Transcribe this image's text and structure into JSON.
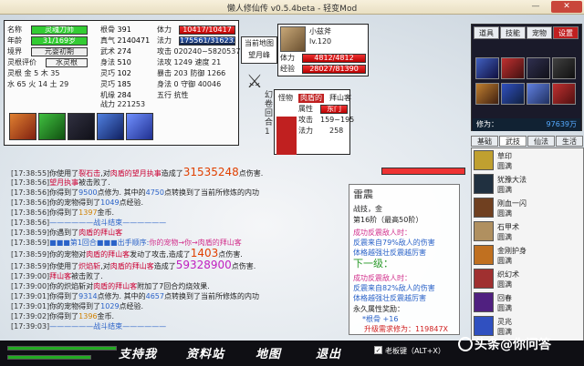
{
  "window": {
    "title": "懒人修仙传 v0.5.4beta - 轻变Mod",
    "minimize": "—",
    "close": "✕"
  },
  "player": {
    "name_label": "名称",
    "name": "灵魂刀师",
    "age_label": "年龄",
    "age": "31/169岁",
    "realm_label": "境界",
    "realm": "元婴初期",
    "root_label": "灵根评价",
    "root": "水灵根",
    "attr_label": "灵根",
    "attrs": "金 5 木 35",
    "attrs2": "水 65 火 14 土 29",
    "stats": [
      {
        "l": "根骨",
        "v": "391"
      },
      {
        "l": "真气",
        "v": "2140471"
      },
      {
        "l": "武术",
        "v": "274"
      },
      {
        "l": "身法",
        "v": "510"
      },
      {
        "l": "灵巧",
        "v": "102"
      },
      {
        "l": "灵巧",
        "v": "185"
      },
      {
        "l": "机缘",
        "v": "284"
      }
    ],
    "hp_label": "体力",
    "hp": "10417/10417",
    "mp_label": "法力",
    "mp": "175561/316232",
    "atk_label": "攻击",
    "atk": "020240~5820537",
    "def_label": "法攻",
    "def": "1249 速度 21",
    "crit_label": "暴击",
    "crit": "203 防御 1266",
    "speed_label": "身法",
    "speed": "0 守御 40046",
    "lvl_label": "战力",
    "lvl": "221253",
    "elem_label": "五行",
    "elem": "抗性"
  },
  "map": {
    "label": "当前地图",
    "name": "望月峰"
  },
  "pet": {
    "name": "小兹斧",
    "level": "lv.120",
    "hp_label": "体力",
    "hp": "4812/4812",
    "exp_label": "经验",
    "exp": "28027/81390"
  },
  "monster": {
    "label": "怪物",
    "name": "肉盾的",
    "name2": "拜山客",
    "type_label": "属性",
    "type": "东门",
    "atk_label": "攻击",
    "atk": "159~195",
    "hp_label": "法力",
    "hp": "258",
    "side": "幻 卷 回 合 1"
  },
  "right": {
    "tabs": [
      "道具",
      "技能",
      "宠物",
      "设置"
    ],
    "cult_label": "修为：",
    "cult": "97639万",
    "subtabs": [
      "基础",
      "武技",
      "仙法",
      "生活"
    ]
  },
  "skills": [
    {
      "n": "草印",
      "l": "圆满"
    },
    {
      "n": "犹豫大法",
      "l": "圆满"
    },
    {
      "n": "刚血一闪",
      "l": "圆满"
    },
    {
      "n": "石甲术",
      "l": "圆满"
    },
    {
      "n": "金刚护身",
      "l": "圆满"
    },
    {
      "n": "织幻术",
      "l": "圆满"
    },
    {
      "n": "回春",
      "l": "圆满"
    },
    {
      "n": "灵兆",
      "l": "圆满"
    }
  ],
  "log": [
    {
      "t": "[17:38:55]",
      "a": "你使用了",
      "s": "裂石击",
      "b": ",对",
      "m": "肉盾的望月执事",
      "c": "造成了",
      "num": "31535248",
      "d": "点伤害."
    },
    {
      "t": "[17:38:56]",
      "a": "",
      "s": "望月执事",
      "b": "被击败了.",
      "m": "",
      "c": "",
      "num": "",
      "d": ""
    },
    {
      "t": "[17:38:56]",
      "a": "你得到了",
      "s": "9500",
      "b": "点修为. 其中的",
      "m": "4750",
      "c": "点转换到了当前所修炼的内功",
      "num": "",
      "d": ""
    },
    {
      "t": "[17:38:56]",
      "a": "你的宠物得到了",
      "s": "1049",
      "b": "点经验.",
      "m": "",
      "c": "",
      "num": "",
      "d": ""
    },
    {
      "t": "[17:38:56]",
      "a": "你得到了",
      "s": "1397",
      "b": "金币.",
      "m": "",
      "c": "",
      "num": "",
      "d": ""
    },
    {
      "t": "[17:38:56]",
      "a": "——————",
      "s": "战斗结束",
      "b": "——————",
      "m": "",
      "c": "",
      "num": "",
      "d": ""
    },
    {
      "t": "[17:38:59]",
      "a": "你遇到了",
      "s": "肉盾的",
      "b": "拜山客",
      "m": "",
      "c": "",
      "num": "",
      "d": ""
    },
    {
      "t": "[17:38:59]",
      "a": "■■■第1回合■■■",
      "s": "出手顺序:",
      "b": "你的宠物→你→肉盾的拜山客",
      "m": "",
      "c": "",
      "num": "",
      "d": ""
    },
    {
      "t": "[17:38:59]",
      "a": "你的宠物对",
      "s": "肉盾的拜山客",
      "b": "发动了攻击,造成了",
      "m": "",
      "c": "",
      "num": "1403",
      "d": "点伤害."
    },
    {
      "t": "[17:38:59]",
      "a": "你使用了",
      "s": "炽焰斩",
      "b": ",对",
      "m": "肉盾的拜山客",
      "c": "造成了",
      "num": "59328900",
      "d": "点伤害."
    },
    {
      "t": "[17:39:00]",
      "a": "",
      "s": "拜山客",
      "b": "被击败了.",
      "m": "",
      "c": "",
      "num": "",
      "d": ""
    },
    {
      "t": "[17:39:00]",
      "a": "你的炽焰斩对",
      "s": "肉盾的拜山客",
      "b": "附加了7回合灼烧效果.",
      "m": "",
      "c": "",
      "num": "",
      "d": ""
    },
    {
      "t": "[17:39:01]",
      "a": "你得到了",
      "s": "9314",
      "b": "点修为. 其中的",
      "m": "4657",
      "c": "点转换到了当前所修炼的内功",
      "num": "",
      "d": ""
    },
    {
      "t": "[17:39:01]",
      "a": "你的宠物得到了",
      "s": "1029",
      "b": "点经验.",
      "m": "",
      "c": "",
      "num": "",
      "d": ""
    },
    {
      "t": "[17:39:02]",
      "a": "你得到了",
      "s": "1396",
      "b": "金币.",
      "m": "",
      "c": "",
      "num": "",
      "d": ""
    },
    {
      "t": "[17:39:03]",
      "a": "——————",
      "s": "战斗结束",
      "b": "——————",
      "m": "",
      "c": "",
      "num": "",
      "d": ""
    }
  ],
  "tooltip": {
    "title": "雷震",
    "type": "战技，金",
    "level": "第16阶（最高50阶）",
    "l1": "成功反震敌人时：",
    "l2": "反震来自79%敌人的伤害",
    "l3": "体格越强壮反震越厉害",
    "next": "下一级：",
    "l4": "成功反震敌人时：",
    "l5": "反震来自82%敌人的伤害",
    "l6": "体格越强壮反震越厉害",
    "perm": "永久属性奖励：",
    "perm_v": "*根骨 +16",
    "cost": "升级需求修为：119847X"
  },
  "bottom": {
    "nav": [
      "支持我",
      "资料站",
      "地图",
      "退出"
    ],
    "chk": "✓",
    "chk_label": "老板键（ALT+X）",
    "watermark": "头条@你问答"
  },
  "colors": {
    "hp": "#e33",
    "mp": "#36c"
  }
}
